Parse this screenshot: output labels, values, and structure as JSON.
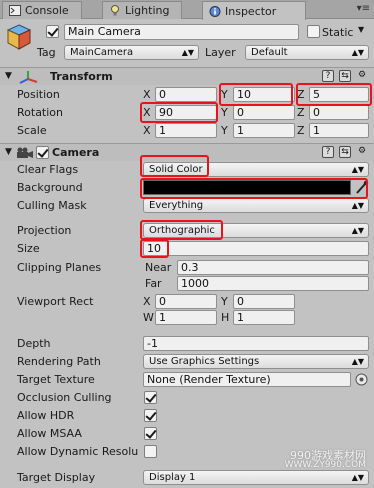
{
  "tabs": [
    {
      "label": "Console",
      "icon": "console-icon"
    },
    {
      "label": "Lighting",
      "icon": "lightbulb-icon"
    },
    {
      "label": "Inspector",
      "icon": "info-icon"
    }
  ],
  "header": {
    "name": "Main Camera",
    "static_label": "Static",
    "tag_label": "Tag",
    "tag_value": "MainCamera",
    "layer_label": "Layer",
    "layer_value": "Default"
  },
  "transform": {
    "title": "Transform",
    "position_label": "Position",
    "rotation_label": "Rotation",
    "scale_label": "Scale",
    "position": {
      "x": "0",
      "y": "10",
      "z": "5"
    },
    "rotation": {
      "x": "90",
      "y": "0",
      "z": "0"
    },
    "scale": {
      "x": "1",
      "y": "1",
      "z": "1"
    },
    "axis": {
      "x": "X",
      "y": "Y",
      "z": "Z"
    }
  },
  "camera": {
    "title": "Camera",
    "clear_flags_label": "Clear Flags",
    "clear_flags_value": "Solid Color",
    "background_label": "Background",
    "background_color": "#000000",
    "culling_mask_label": "Culling Mask",
    "culling_mask_value": "Everything",
    "projection_label": "Projection",
    "projection_value": "Orthographic",
    "size_label": "Size",
    "size_value": "10",
    "clipping_label": "Clipping Planes",
    "near_label": "Near",
    "near_value": "0.3",
    "far_label": "Far",
    "far_value": "1000",
    "viewport_label": "Viewport Rect",
    "viewport": {
      "x": "0",
      "y": "0",
      "w": "1",
      "h": "1"
    },
    "viewport_axis": {
      "x": "X",
      "y": "Y",
      "w": "W",
      "h": "H"
    },
    "depth_label": "Depth",
    "depth_value": "-1",
    "rendering_path_label": "Rendering Path",
    "rendering_path_value": "Use Graphics Settings",
    "target_texture_label": "Target Texture",
    "target_texture_value": "None (Render Texture)",
    "occlusion_label": "Occlusion Culling",
    "hdr_label": "Allow HDR",
    "msaa_label": "Allow MSAA",
    "dynres_label": "Allow Dynamic Resolu",
    "target_display_label": "Target Display",
    "target_display_value": "Display 1"
  },
  "watermark": {
    "line1": "990游戏素材网",
    "line2": "WWW.ZY990.COM"
  },
  "colors": {
    "highlight": "#e8141b",
    "panel": "#c2c2c2"
  }
}
